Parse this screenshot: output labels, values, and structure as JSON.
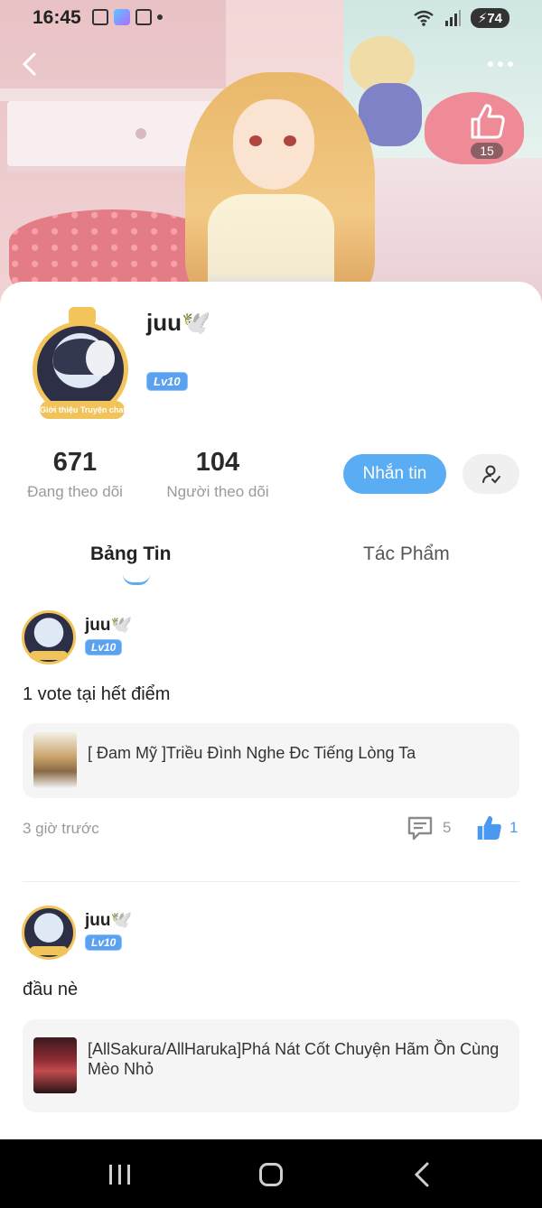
{
  "status_bar": {
    "time": "16:45",
    "battery": "74"
  },
  "cover": {
    "like_count": "15"
  },
  "profile": {
    "username": "juu🕊️",
    "level": "Lv10",
    "frame_label": "Giới thiệu Truyện chat",
    "following_count": "671",
    "following_label": "Đang theo dõi",
    "followers_count": "104",
    "followers_label": "Người theo dõi",
    "message_button": "Nhắn tin"
  },
  "tabs": [
    {
      "label": "Bảng Tin",
      "active": true
    },
    {
      "label": "Tác Phẩm",
      "active": false
    }
  ],
  "posts": [
    {
      "author": "juu🕊️",
      "level": "Lv10",
      "text": "1 vote tại hết điểm",
      "card_title": "[ Đam Mỹ ]Triều Đình Nghe Đc Tiếng Lòng Ta",
      "time": "3 giờ trước",
      "comments": "5",
      "likes": "1"
    },
    {
      "author": "juu🕊️",
      "level": "Lv10",
      "text": "đầu nè",
      "card_title": "[AllSakura/AllHaruka]Phá Nát Cốt Chuyện Hãm Ồn Cùng Mèo Nhỏ",
      "time": "",
      "comments": "",
      "likes": ""
    }
  ],
  "colors": {
    "accent": "#5aacf3",
    "like_blue": "#4a98f0",
    "level_badge": "#5aa2f0",
    "frame_gold": "#f2c45b"
  },
  "icons": {
    "back": "chevron-left-icon",
    "more": "more-dots-icon",
    "like": "thumbs-up-icon",
    "comment": "comment-icon",
    "follow": "user-follow-icon"
  }
}
